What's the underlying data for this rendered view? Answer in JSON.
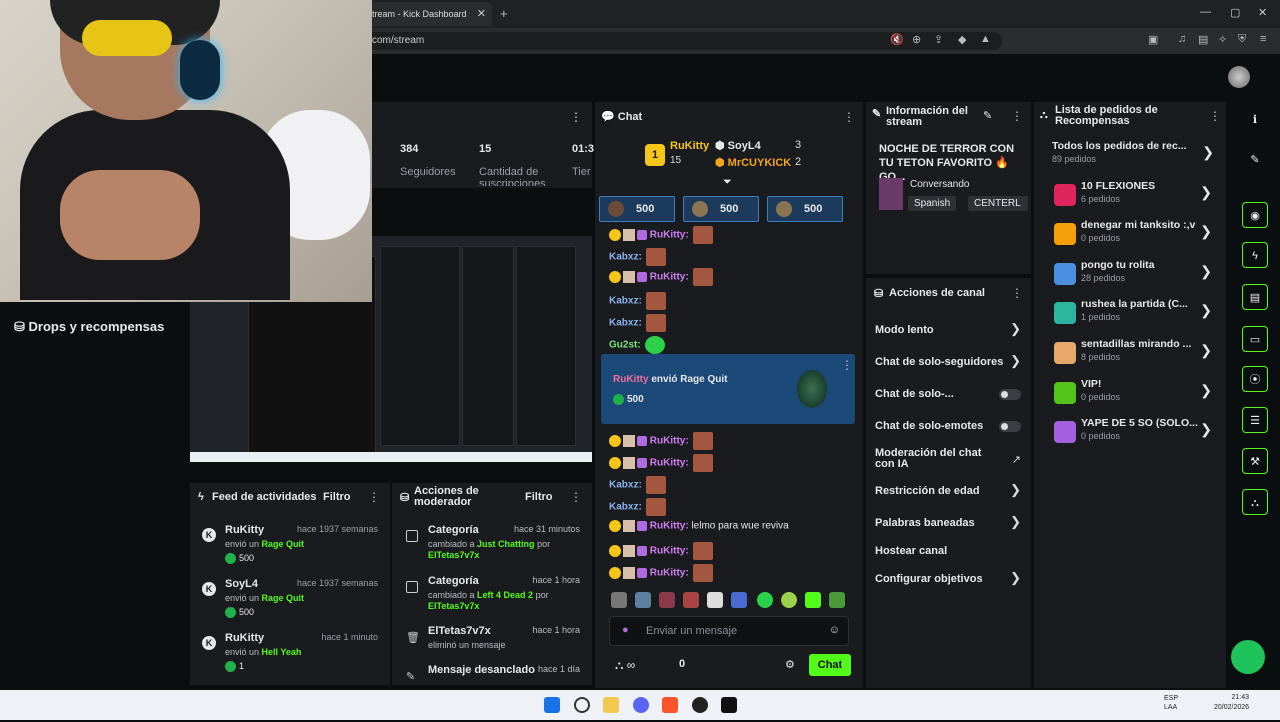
{
  "browser": {
    "tab_title": "tream - Kick Dashboard",
    "url": "com/stream"
  },
  "sidebar": {
    "drops": "Drops y recompensas"
  },
  "stats": {
    "followers_val": "384",
    "followers_lbl": "Seguidores",
    "subs_val": "15",
    "subs_lbl": "Cantidad de suscripciones",
    "time_val": "01:3",
    "time_lbl": "Tier"
  },
  "chat": {
    "title": "Chat",
    "leaderboard": {
      "first_name": "RuKitty",
      "first_count": "15",
      "second_name": "SoyL4",
      "second_count": "3",
      "third_name": "MrCUYKICK",
      "third_count": "2"
    },
    "gifts": [
      "500",
      "500",
      "500"
    ],
    "messages": [
      {
        "user": "RuKitty:",
        "text": ""
      },
      {
        "user": "Kabxz:",
        "text": ""
      },
      {
        "user": "RuKitty:",
        "text": ""
      },
      {
        "user": "Kabxz:",
        "text": ""
      },
      {
        "user": "Kabxz:",
        "text": ""
      },
      {
        "user": "Gu2st:",
        "text": ""
      }
    ],
    "ragequit": {
      "user": "RuKitty",
      "verb": "envió",
      "gift": "Rage Quit",
      "amount": "500"
    },
    "messages2": [
      {
        "user": "RuKitty:",
        "text": ""
      },
      {
        "user": "RuKitty:",
        "text": ""
      },
      {
        "user": "Kabxz:",
        "text": ""
      },
      {
        "user": "Kabxz:",
        "text": ""
      },
      {
        "user": "RuKitty:",
        "text": " lelmo para wue reviva"
      },
      {
        "user": "RuKitty:",
        "text": ""
      },
      {
        "user": "RuKitty:",
        "text": ""
      }
    ],
    "input_placeholder": "Enviar un mensaje",
    "points": "0",
    "send": "Chat"
  },
  "feed": {
    "title": "Feed de actividades",
    "filter": "Filtro",
    "items": [
      {
        "user": "RuKitty",
        "time": "hace 1937 semanas",
        "verb": "envió un",
        "gift": "Rage Quit",
        "amount": "500"
      },
      {
        "user": "SoyL4",
        "time": "hace 1937 semanas",
        "verb": "envió un",
        "gift": "Rage Quit",
        "amount": "500"
      },
      {
        "user": "RuKitty",
        "time": "hace 1 minuto",
        "verb": "envió un",
        "gift": "Hell Yeah",
        "amount": "1"
      }
    ]
  },
  "mod": {
    "title": "Acciones de moderador",
    "filter": "Filtro",
    "items": [
      {
        "title": "Categoría",
        "time": "hace 31 minutos",
        "line_a": "cambiado a",
        "line_b": "Just Chatting",
        "line_c": "por",
        "by": "ElTetas7v7x"
      },
      {
        "title": "Categoría",
        "time": "hace 1 hora",
        "line_a": "cambiado a",
        "line_b": "Left 4 Dead 2",
        "line_c": "por",
        "by": "ElTetas7v7x"
      },
      {
        "title": "ElTetas7v7x",
        "time": "hace 1 hora",
        "line_a": "eliminó un mensaje",
        "line_b": "",
        "line_c": "",
        "by": ""
      },
      {
        "title": "Mensaje desanclado",
        "time": "hace 1 día",
        "line_a": "",
        "line_b": "",
        "line_c": "",
        "by": ""
      }
    ]
  },
  "info": {
    "title": "Información del stream",
    "stream_title": "NOCHE DE TERROR CON TU TETON FAVORITO 🔥 GO...",
    "category": "Conversando",
    "lang": "Spanish",
    "tag": "CENTERL"
  },
  "actions": {
    "title": "Acciones de canal",
    "items": [
      "Modo lento",
      "Chat de solo-seguidores",
      "Chat de solo-...",
      "Chat de solo-emotes",
      "Moderación del chat con IA",
      "Restricción de edad",
      "Palabras baneadas",
      "Hostear canal",
      "Configurar objetivos"
    ]
  },
  "requests": {
    "title": "Lista de pedidos de Recompensas",
    "items": [
      {
        "name": "Todos los pedidos de rec...",
        "count": "89 pedidos",
        "color": "#191b1f"
      },
      {
        "name": "10 FLEXIONES",
        "count": "6 pedidos",
        "color": "#e0245e"
      },
      {
        "name": "denegar mi tanksito :,v",
        "count": "0 pedidos",
        "color": "#f59f0a"
      },
      {
        "name": "pongo tu rolita",
        "count": "28 pedidos",
        "color": "#4a8fe0"
      },
      {
        "name": "rushea la partida (C...",
        "count": "1 pedidos",
        "color": "#2bb6a0"
      },
      {
        "name": "sentadillas mirando ...",
        "count": "8 pedidos",
        "color": "#e8a86a"
      },
      {
        "name": "VIP!",
        "count": "0 pedidos",
        "color": "#53c41a"
      },
      {
        "name": "YAPE DE 5 SO (SOLO...",
        "count": "0 pedidos",
        "color": "#a45ee0"
      }
    ]
  },
  "taskbar": {
    "time": "21:43",
    "date": "20/02/2026",
    "lang": "ESP LAA"
  }
}
